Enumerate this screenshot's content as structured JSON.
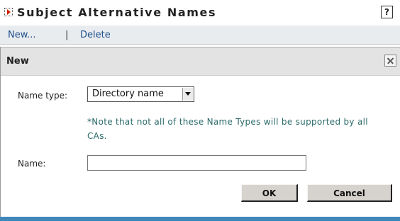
{
  "header": {
    "title": "Subject Alternative Names",
    "help_glyph": "?",
    "toggle_icon": "expand-arrow-icon"
  },
  "actions": {
    "new_label": "New...",
    "separator": "|",
    "delete_label": "Delete"
  },
  "dialog": {
    "title": "New",
    "close_icon": "close-icon",
    "name_type_label": "Name type:",
    "name_type_value": "Directory name",
    "note": "*Note that not all of these Name Types will be supported by all CAs.",
    "name_label": "Name:",
    "name_value": "",
    "ok_label": "OK",
    "cancel_label": "Cancel"
  },
  "colors": {
    "link": "#1f4f8a",
    "note": "#2c6a6a",
    "accent_bar": "#3f87b9",
    "toggle_arrow": "#cc2200"
  }
}
